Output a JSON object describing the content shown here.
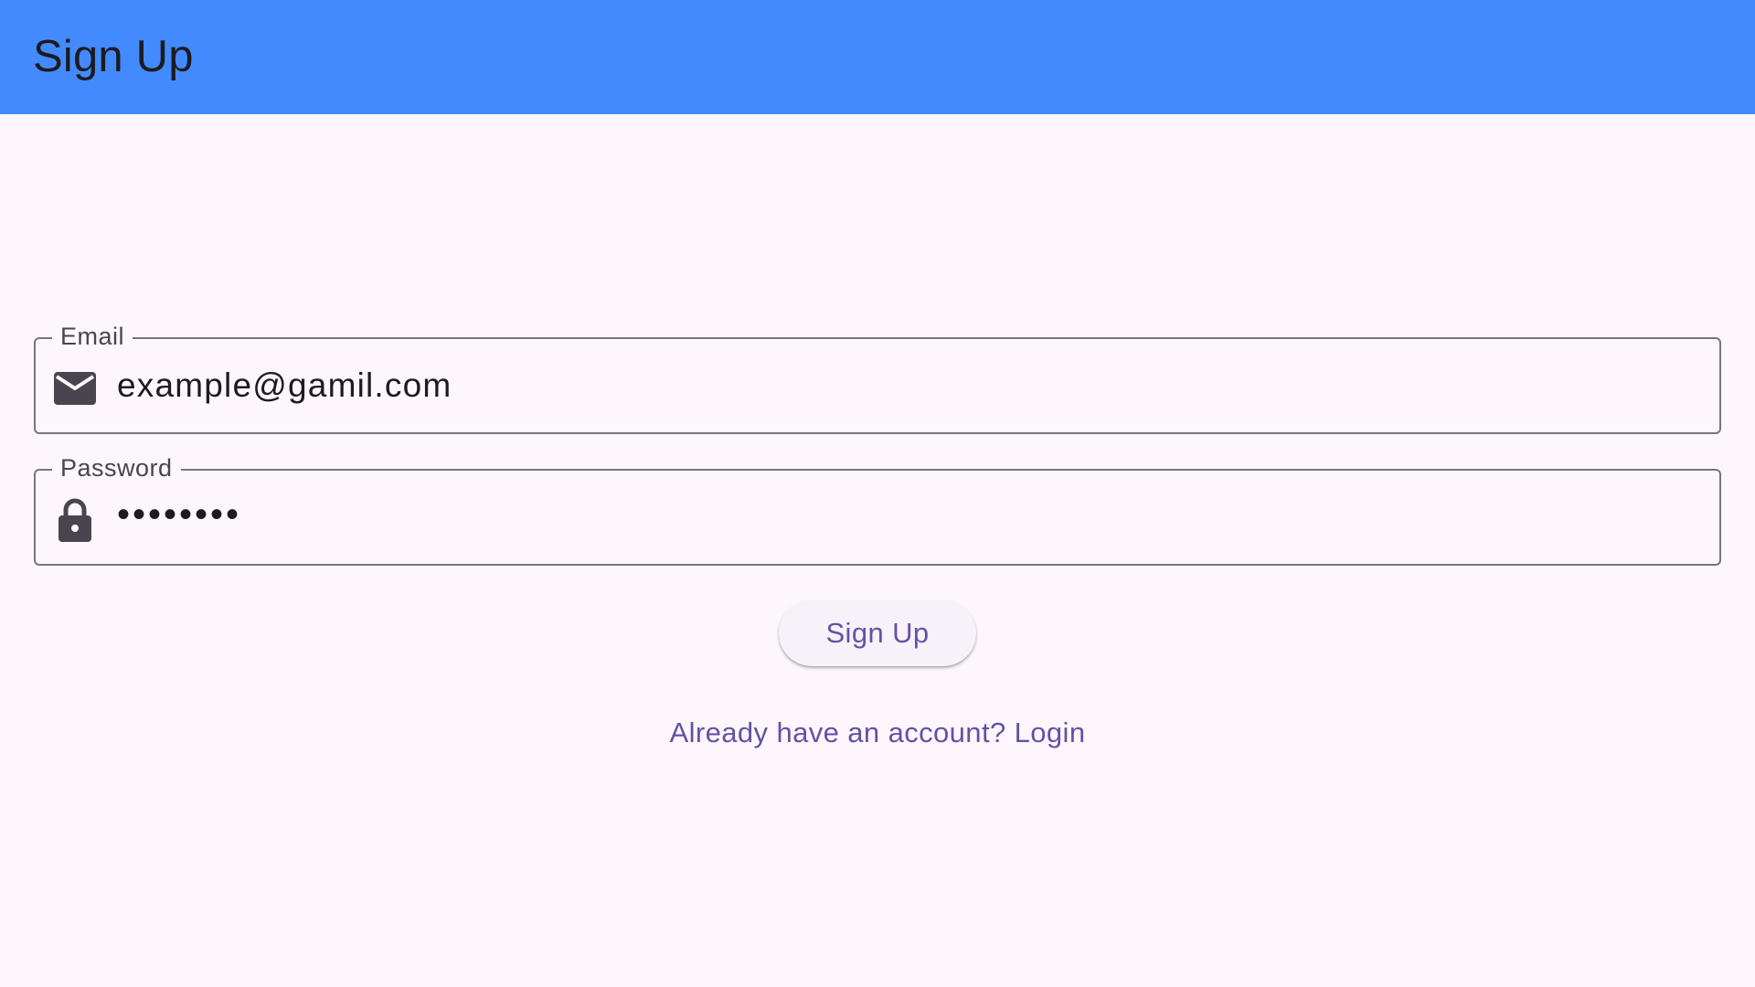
{
  "app_bar": {
    "title": "Sign Up",
    "background_color": "#448aff"
  },
  "form": {
    "email": {
      "label": "Email",
      "value": "example@gamil.com",
      "icon": "email-icon"
    },
    "password": {
      "label": "Password",
      "value": "••••••••",
      "icon": "lock-icon"
    },
    "submit_label": "Sign Up",
    "login_link": "Already have an account? Login"
  },
  "colors": {
    "accent": "#6750a4",
    "background": "#fdf7fd",
    "outline": "#79747e"
  }
}
